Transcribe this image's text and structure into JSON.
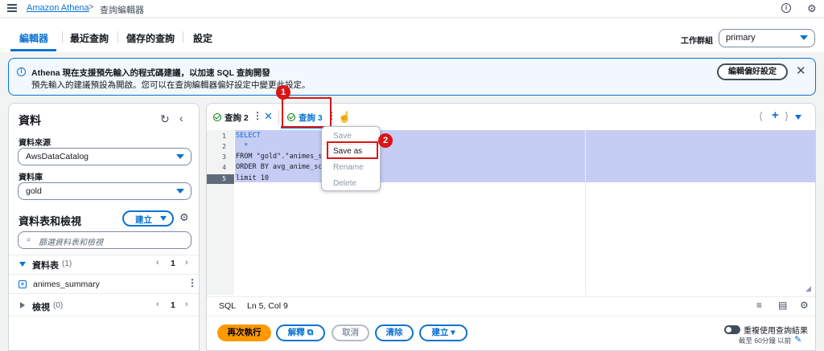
{
  "breadcrumb": {
    "parent": "Amazon Athena",
    "separator": ">",
    "current": "查詢編輯器"
  },
  "main_tabs": [
    {
      "label": "編輯器",
      "active": true
    },
    {
      "label": "最近查詢",
      "active": false
    },
    {
      "label": "儲存的查詢",
      "active": false
    },
    {
      "label": "設定",
      "active": false
    }
  ],
  "workgroup": {
    "label": "工作群組",
    "value": "primary"
  },
  "banner": {
    "title": "Athena 現在支援預先輸入的程式碼建議，以加速 SQL 查詢開發",
    "text": "預先輸入的建議預設為開啟。您可以在查詢編輯器偏好設定中變更此設定。",
    "button": "編輯偏好設定"
  },
  "data_panel": {
    "title": "資料",
    "source_label": "資料來源",
    "source_value": "AwsDataCatalog",
    "db_label": "資料庫",
    "db_value": "gold",
    "tables_views_title": "資料表和檢視",
    "create_button": "建立",
    "search_placeholder": "篩選資料表和檢視",
    "tables_section": "資料表",
    "tables_count": "(1)",
    "tables_page": "1",
    "table_item": "animes_summary",
    "views_section": "檢視",
    "views_count": "(0)",
    "views_page": "1"
  },
  "query_tabs": [
    {
      "label": "查詢 2",
      "active": false
    },
    {
      "label": "查詢 3",
      "active": true
    }
  ],
  "editor": {
    "line_numbers": [
      "1",
      "2",
      "3",
      "4",
      "5"
    ],
    "lines": [
      "SELECT",
      "  *",
      "FROM \"gold\".\"animes_s",
      "ORDER BY avg_anime_sc",
      "limit 10"
    ],
    "status_lang": "SQL",
    "status_pos": "Ln 5, Col 9"
  },
  "context_menu": {
    "items": [
      {
        "label": "Save",
        "enabled": false
      },
      {
        "label": "Save as",
        "enabled": true
      },
      {
        "label": "Rename",
        "enabled": false
      },
      {
        "label": "Delete",
        "enabled": false
      }
    ]
  },
  "annotations": {
    "step1": "1",
    "step2": "2"
  },
  "actions": {
    "run_again": "再次執行",
    "explain": "解釋",
    "cancel": "取消",
    "clear": "清除",
    "create": "建立"
  },
  "reuse": {
    "label": "重複使用查詢結果",
    "sub": "截至 60分鐘 以前"
  },
  "colors": {
    "accent": "#0972d3",
    "primary_button": "#ff9900",
    "highlight": "#d91515",
    "success": "#037f0c"
  },
  "icons": [
    "menu-icon",
    "info-icon",
    "settings-icon",
    "refresh-icon",
    "collapse-icon",
    "search-icon",
    "table-icon",
    "check-circle-icon",
    "close-icon",
    "more-vertical-icon",
    "plus-icon",
    "pointer-cursor-icon",
    "external-link-icon",
    "pencil-icon"
  ]
}
